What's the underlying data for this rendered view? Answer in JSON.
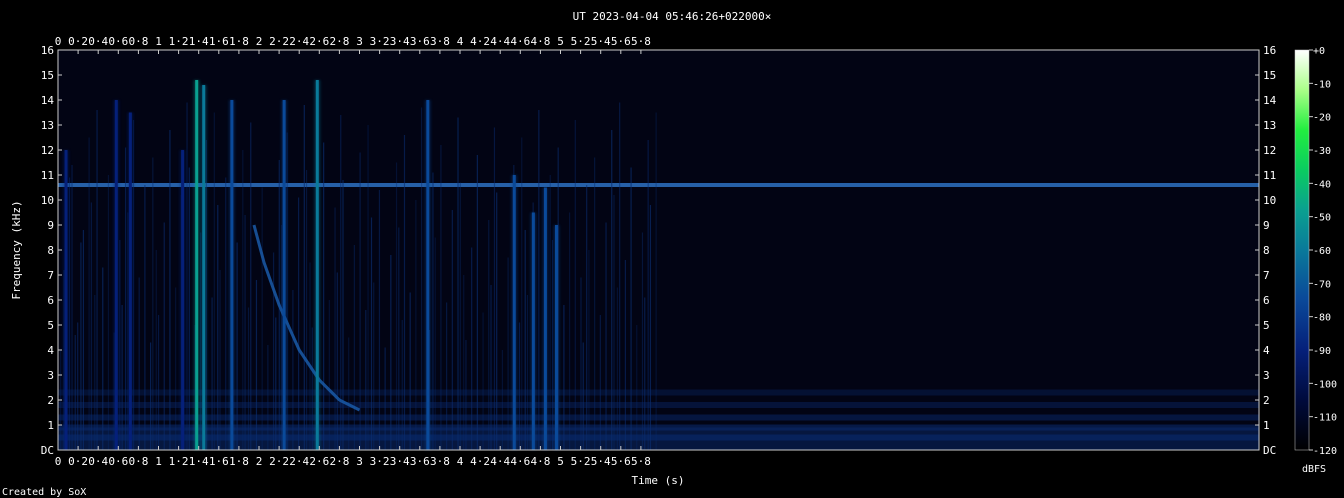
{
  "chart_data": {
    "type": "heatmap",
    "title": "UT 2023-04-04 05:46:26+022000×",
    "xlabel": "Time (s)",
    "ylabel": "Frequency (kHz)",
    "xlim": [
      0,
      5.98
    ],
    "ylim": [
      0,
      16
    ],
    "x_ticks": [
      "0",
      "0·2",
      "0·4",
      "0·6",
      "0·8",
      "1",
      "1·2",
      "1·4",
      "1·6",
      "1·8",
      "2",
      "2·2",
      "2·4",
      "2·6",
      "2·8",
      "3",
      "3·2",
      "3·4",
      "3·6",
      "3·8",
      "4",
      "4·2",
      "4·4",
      "4·6",
      "4·8",
      "5",
      "5·2",
      "5·4",
      "5·6",
      "5·8"
    ],
    "y_ticks": [
      "DC",
      "1",
      "2",
      "3",
      "4",
      "5",
      "6",
      "7",
      "8",
      "9",
      "10",
      "11",
      "12",
      "13",
      "14",
      "15",
      "16"
    ],
    "colorbar": {
      "label": "dBFS",
      "range": [
        -120,
        0
      ],
      "ticks": [
        "+0",
        "-10",
        "-20",
        "-30",
        "-40",
        "-50",
        "-60",
        "-70",
        "-80",
        "-90",
        "-100",
        "-110",
        "-120"
      ]
    },
    "colormap": [
      "#000000",
      "#000a3a",
      "#05207a",
      "#0a4a9a",
      "#0a7a9a",
      "#0aa090",
      "#0acc60",
      "#22ee40",
      "#aaff88",
      "#ffffff"
    ],
    "features": {
      "horizontal_band": {
        "freq_khz": 10.6,
        "level_dbfs": -88
      },
      "low_bands_khz": [
        0.5,
        0.9,
        1.3,
        1.8,
        2.3
      ],
      "bright_impulses": [
        {
          "t": 1.38,
          "fmax_khz": 14.8,
          "level_dbfs": -60
        },
        {
          "t": 1.45,
          "fmax_khz": 14.6,
          "level_dbfs": -62
        },
        {
          "t": 2.58,
          "fmax_khz": 14.8,
          "level_dbfs": -70
        },
        {
          "t": 4.73,
          "fmax_khz": 9.5,
          "level_dbfs": -75
        },
        {
          "t": 4.85,
          "fmax_khz": 10.5,
          "level_dbfs": -78
        },
        {
          "t": 1.73,
          "fmax_khz": 14.0,
          "level_dbfs": -82
        },
        {
          "t": 2.25,
          "fmax_khz": 14.0,
          "level_dbfs": -85
        },
        {
          "t": 3.68,
          "fmax_khz": 14.0,
          "level_dbfs": -86
        },
        {
          "t": 0.58,
          "fmax_khz": 14.0,
          "level_dbfs": -88
        },
        {
          "t": 0.72,
          "fmax_khz": 13.5,
          "level_dbfs": -88
        },
        {
          "t": 4.54,
          "fmax_khz": 11.0,
          "level_dbfs": -84
        },
        {
          "t": 4.96,
          "fmax_khz": 9.0,
          "level_dbfs": -86
        },
        {
          "t": 0.08,
          "fmax_khz": 12.0,
          "level_dbfs": -92
        },
        {
          "t": 1.24,
          "fmax_khz": 12.0,
          "level_dbfs": -94
        }
      ],
      "whistler_curve": [
        {
          "t": 1.95,
          "f": 9.0
        },
        {
          "t": 2.05,
          "f": 7.5
        },
        {
          "t": 2.2,
          "f": 5.8
        },
        {
          "t": 2.4,
          "f": 4.0
        },
        {
          "t": 2.6,
          "f": 2.8
        },
        {
          "t": 2.8,
          "f": 2.0
        },
        {
          "t": 3.0,
          "f": 1.6
        }
      ]
    }
  },
  "footer": {
    "credit": "Created by SoX"
  }
}
